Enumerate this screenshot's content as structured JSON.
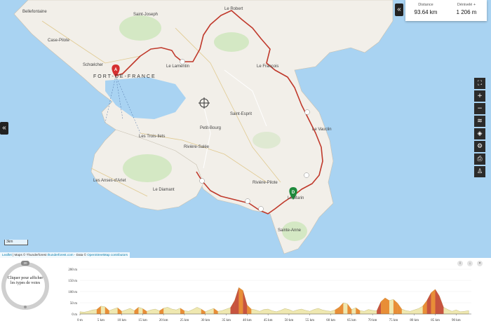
{
  "stats": {
    "distance_label": "Distance",
    "distance_value": "93.64 km",
    "elevation_label": "Dénivelé +",
    "elevation_value": "1 206 m"
  },
  "map": {
    "places": [
      {
        "name": "Bellefontaine"
      },
      {
        "name": "Saint-Joseph"
      },
      {
        "name": "Le Robert"
      },
      {
        "name": "Case-Pilote"
      },
      {
        "name": "Schœlcher"
      },
      {
        "name": "FORT-DE-FRANCE"
      },
      {
        "name": "Le Lamentin"
      },
      {
        "name": "Le François"
      },
      {
        "name": "Saint-Esprit"
      },
      {
        "name": "Petit-Bourg"
      },
      {
        "name": "Le Vauclin"
      },
      {
        "name": "Les Trois-Ilets"
      },
      {
        "name": "Rivière-Salée"
      },
      {
        "name": "Les Anses-d'Arlet"
      },
      {
        "name": "Le Diamant"
      },
      {
        "name": "Rivière-Pilote"
      },
      {
        "name": "Le Marin"
      },
      {
        "name": "Sainte-Anne"
      }
    ],
    "start_marker": "A",
    "end_marker": "D",
    "scale_label": "3km",
    "attribution": {
      "leaflet": "Leaflet",
      "maps": "| Maps © Thunderforest",
      "tf_link": "thunderforest.com",
      "data": "- Data ©",
      "osm_link": "OpenStreetMap contributors"
    },
    "colors": {
      "sea": "#a9d3f2",
      "land": "#f2efe9",
      "route": "#c0392b",
      "start": "#d63031",
      "end": "#1e8a3c"
    }
  },
  "toolbar": {
    "collapse_top": "«",
    "collapse_left": "«",
    "tools": [
      {
        "name": "fullscreen-icon",
        "glyph": "⛶"
      },
      {
        "name": "zoom-in-icon",
        "glyph": "+"
      },
      {
        "name": "zoom-out-icon",
        "glyph": "−"
      },
      {
        "name": "layers-icon",
        "glyph": "≋"
      },
      {
        "name": "layers-alt-icon",
        "glyph": "◈"
      },
      {
        "name": "settings-icon",
        "glyph": "⚙"
      },
      {
        "name": "print-icon",
        "glyph": "⎙"
      },
      {
        "name": "person-icon",
        "glyph": "♙"
      }
    ]
  },
  "profile": {
    "legend_text": "Cliquer pour afficher les types de voies",
    "badge": "20",
    "controls": {
      "info": "i",
      "download": "↓",
      "close": "×"
    },
    "chart_data": {
      "type": "area",
      "y_ticks": [
        "200 m",
        "150 m",
        "100 m",
        "50 m",
        "0 m"
      ],
      "x_ticks": [
        "0 m",
        "5 km",
        "10 km",
        "15 km",
        "20 km",
        "25 km",
        "30 km",
        "35 km",
        "40 km",
        "45 km",
        "50 km",
        "55 km",
        "60 km",
        "65 km",
        "70 km",
        "75 km",
        "80 km",
        "85 km",
        "90 km"
      ],
      "ylim": [
        0,
        200
      ],
      "xlim": [
        0,
        93.64
      ],
      "x": [
        0,
        1,
        2,
        3,
        4,
        5,
        6,
        7,
        8,
        9,
        10,
        11,
        12,
        13,
        14,
        15,
        16,
        17,
        18,
        19,
        20,
        21,
        22,
        23,
        24,
        25,
        26,
        27,
        28,
        29,
        30,
        31,
        32,
        33,
        34,
        35,
        36,
        37,
        38,
        39,
        40,
        41,
        42,
        43,
        44,
        45,
        46,
        47,
        48,
        49,
        50,
        51,
        52,
        53,
        54,
        55,
        56,
        57,
        58,
        59,
        60,
        61,
        62,
        63,
        64,
        65,
        66,
        67,
        68,
        69,
        70,
        71,
        72,
        73,
        74,
        75,
        76,
        77,
        78,
        79,
        80,
        81,
        82,
        83,
        84,
        85,
        86,
        87,
        88,
        89,
        90,
        91,
        92,
        93
      ],
      "elevation": [
        10,
        8,
        12,
        18,
        20,
        35,
        32,
        15,
        22,
        28,
        12,
        18,
        25,
        15,
        30,
        24,
        12,
        18,
        22,
        14,
        26,
        30,
        22,
        18,
        26,
        14,
        12,
        20,
        30,
        22,
        10,
        18,
        25,
        12,
        15,
        22,
        28,
        60,
        118,
        105,
        40,
        22,
        18,
        12,
        20,
        22,
        14,
        10,
        16,
        24,
        20,
        12,
        18,
        22,
        16,
        12,
        20,
        25,
        18,
        14,
        12,
        18,
        30,
        50,
        45,
        20,
        28,
        15,
        12,
        20,
        16,
        14,
        55,
        72,
        60,
        65,
        48,
        22,
        15,
        12,
        18,
        24,
        35,
        60,
        95,
        110,
        80,
        30,
        20,
        12,
        18,
        10,
        12,
        15
      ]
    }
  }
}
